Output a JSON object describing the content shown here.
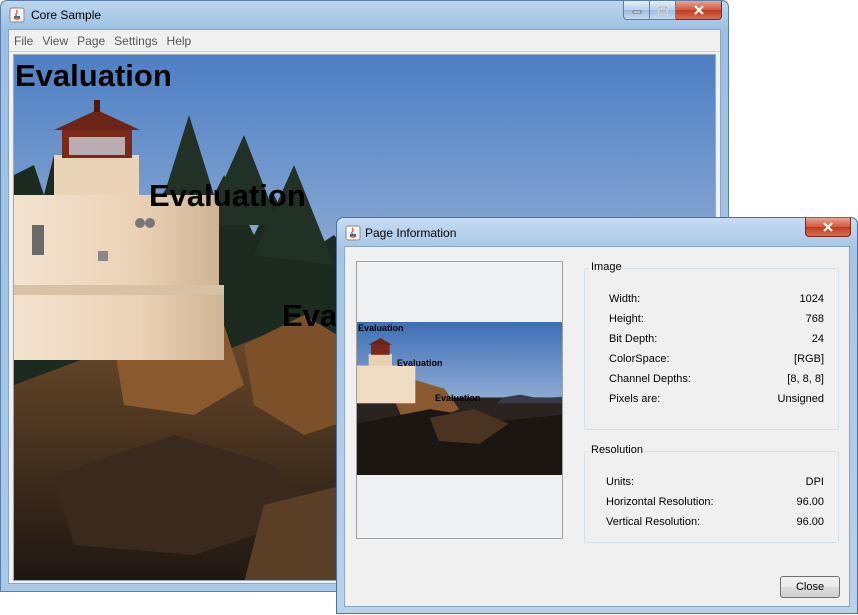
{
  "main_window": {
    "title": "Core Sample",
    "menu": [
      "File",
      "View",
      "Page",
      "Settings",
      "Help"
    ]
  },
  "canvas": {
    "watermarks": [
      "Evaluation",
      "Evaluation",
      "Evaluation"
    ]
  },
  "dialog": {
    "title": "Page Information",
    "preview_watermarks": [
      "Evaluation",
      "Evaluation",
      "Evaluation"
    ],
    "image_group": {
      "title": "Image",
      "rows": [
        {
          "label": "Width:",
          "value": "1024"
        },
        {
          "label": "Height:",
          "value": "768"
        },
        {
          "label": "Bit Depth:",
          "value": "24"
        },
        {
          "label": "ColorSpace:",
          "value": "[RGB]"
        },
        {
          "label": "Channel Depths:",
          "value": "[8, 8, 8]"
        },
        {
          "label": "Pixels are:",
          "value": "Unsigned"
        }
      ]
    },
    "resolution_group": {
      "title": "Resolution",
      "rows": [
        {
          "label": "Units:",
          "value": "DPI"
        },
        {
          "label": "Horizontal Resolution:",
          "value": "96.00"
        },
        {
          "label": "Vertical Resolution:",
          "value": "96.00"
        }
      ]
    },
    "close_label": "Close"
  },
  "colors": {
    "titlebar": "#a9c9e8",
    "close_red": "#c03a1e",
    "client_bg": "#f0f0f0"
  }
}
